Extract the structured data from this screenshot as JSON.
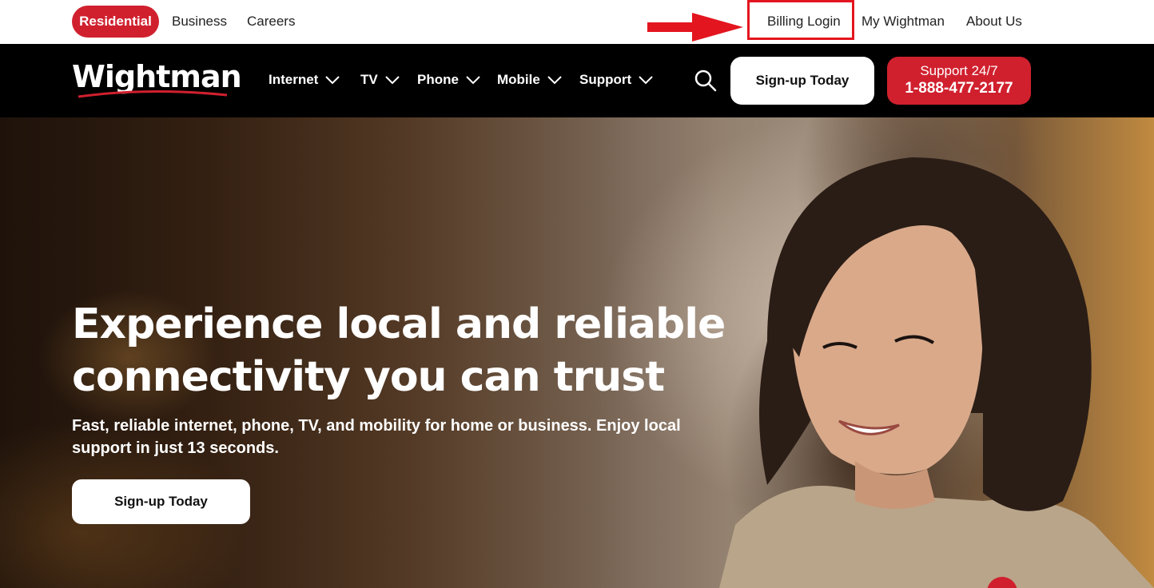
{
  "topbar": {
    "segments": [
      "Residential",
      "Business",
      "Careers"
    ],
    "links": [
      "Billing Login",
      "My Wightman",
      "About Us"
    ]
  },
  "nav": {
    "logo": "Wightman",
    "items": [
      "Internet",
      "TV",
      "Phone",
      "Mobile",
      "Support"
    ],
    "signup": "Sign-up Today",
    "support_line1": "Support 24/7",
    "support_line2": "1-888-477-2177"
  },
  "hero": {
    "title": "Experience local and reliable connectivity you can trust",
    "subtitle": "Fast, reliable internet, phone, TV, and mobility for home or business. Enjoy local support in just 13 seconds.",
    "cta": "Sign-up Today"
  },
  "colors": {
    "brand_red": "#d0202e",
    "annotation_red": "#e3151f",
    "nav_bg": "#000000"
  },
  "icons": [
    "chevron-down-icon",
    "search-icon",
    "annotation-arrow"
  ]
}
